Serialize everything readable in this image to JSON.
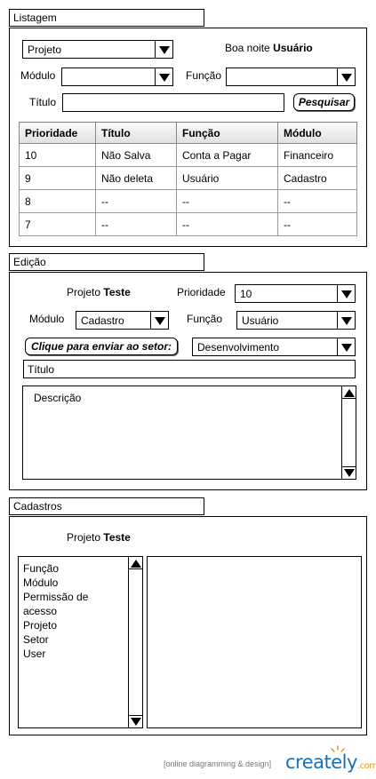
{
  "listagem": {
    "tab_label": "Listagem",
    "projeto_select": "Projeto",
    "greeting": "Boa noite",
    "user": "Usuário",
    "modulo_label": "Módulo",
    "modulo_value": "",
    "funcao_label": "Função",
    "funcao_value": "",
    "titulo_label": "Título",
    "titulo_value": "",
    "search_button": "Pesquisar",
    "table": {
      "headers": [
        "Prioridade",
        "Título",
        "Função",
        "Módulo"
      ],
      "rows": [
        [
          "10",
          "Não Salva",
          "Conta a Pagar",
          "Financeiro"
        ],
        [
          "9",
          "Não deleta",
          "Usuário",
          "Cadastro"
        ],
        [
          "8",
          "--",
          "--",
          "--"
        ],
        [
          "7",
          "--",
          "--",
          "--"
        ]
      ]
    }
  },
  "edicao": {
    "tab_label": "Edição",
    "projeto_label": "Projeto",
    "projeto_name": "Teste",
    "prioridade_label": "Prioridade",
    "prioridade_value": "10",
    "modulo_label": "Módulo",
    "modulo_value": "Cadastro",
    "funcao_label": "Função",
    "funcao_value": "Usuário",
    "send_button": "Clique para enviar ao setor:",
    "setor_value": "Desenvolvimento",
    "titulo_value": "Título",
    "descricao_value": "Descrição"
  },
  "cadastros": {
    "tab_label": "Cadastros",
    "projeto_label": "Projeto",
    "projeto_name": "Teste",
    "items": [
      "Função",
      "Módulo",
      "Permissão de",
      "acesso",
      "Projeto",
      "Setor",
      "User"
    ]
  },
  "footer": {
    "tagline": "[online diagramming & design]",
    "brand": "creately",
    "brand_tld": ".com",
    "brand_color": "#1a6fb8",
    "tld_color": "#e59a1b",
    "tagline_color": "#777777"
  }
}
